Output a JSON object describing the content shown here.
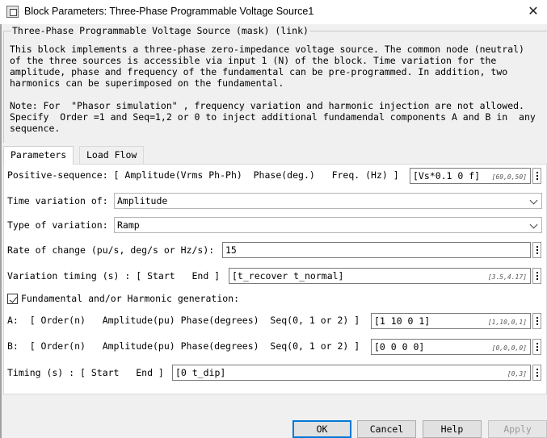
{
  "window": {
    "title": "Block Parameters: Three-Phase Programmable Voltage Source1",
    "close_glyph": "✕",
    "icon": "block-app-icon"
  },
  "mask": {
    "title": "Three-Phase Programmable Voltage Source (mask) (link)",
    "description": "This block implements a three-phase zero-impedance voltage source. The common node (neutral)\nof the three sources is accessible via input 1 (N) of the block. Time variation for the\namplitude, phase and frequency of the fundamental can be pre-programmed. In addition, two\nharmonics can be superimposed on the fundamental.",
    "note": "Note: For  \"Phasor simulation\" , frequency variation and harmonic injection are not allowed.\nSpecify  Order =1 and Seq=1,2 or 0 to inject additional fundamendal components A and B in  any\nsequence."
  },
  "tabs": [
    {
      "label": "Parameters",
      "active": true
    },
    {
      "label": "Load Flow",
      "active": false
    }
  ],
  "params": {
    "positive_sequence": {
      "label": "Positive-sequence: [ Amplitude(Vrms Ph-Ph)  Phase(deg.)   Freq. (Hz) ]",
      "value": "[Vs*0.1  0 f]",
      "hint": "[69,0,50]"
    },
    "time_variation": {
      "label": "Time variation of:",
      "selected": "Amplitude"
    },
    "type_of_variation": {
      "label": "Type of variation:",
      "selected": "Ramp"
    },
    "rate_of_change": {
      "label": "Rate of change (pu/s, deg/s or Hz/s):",
      "value": "15"
    },
    "variation_timing": {
      "label": "Variation timing (s) : [ Start   End ]",
      "value": "[t_recover t_normal]",
      "hint": "[3.5,4.17]"
    },
    "harmonic_generation": {
      "label": "Fundamental and/or Harmonic generation:",
      "checked": true
    },
    "harmonic_a": {
      "label": "A:  [ Order(n)   Amplitude(pu) Phase(degrees)  Seq(0, 1 or 2) ]",
      "value": "[1 10 0 1]",
      "hint": "[1,10,0,1]"
    },
    "harmonic_b": {
      "label": "B:  [ Order(n)   Amplitude(pu) Phase(degrees)  Seq(0, 1 or 2) ]",
      "value": "[0 0 0 0]",
      "hint": "[0,0,0,0]"
    },
    "timing": {
      "label": "Timing (s) : [ Start   End ]",
      "value": "[0  t_dip]",
      "hint": "[0,3]"
    }
  },
  "buttons": {
    "ok": "OK",
    "cancel": "Cancel",
    "help": "Help",
    "apply": "Apply"
  },
  "colors": {
    "dialog_bg": "#f0f0f0",
    "panel_bg": "#ffffff",
    "default_button_border": "#0078d7"
  }
}
